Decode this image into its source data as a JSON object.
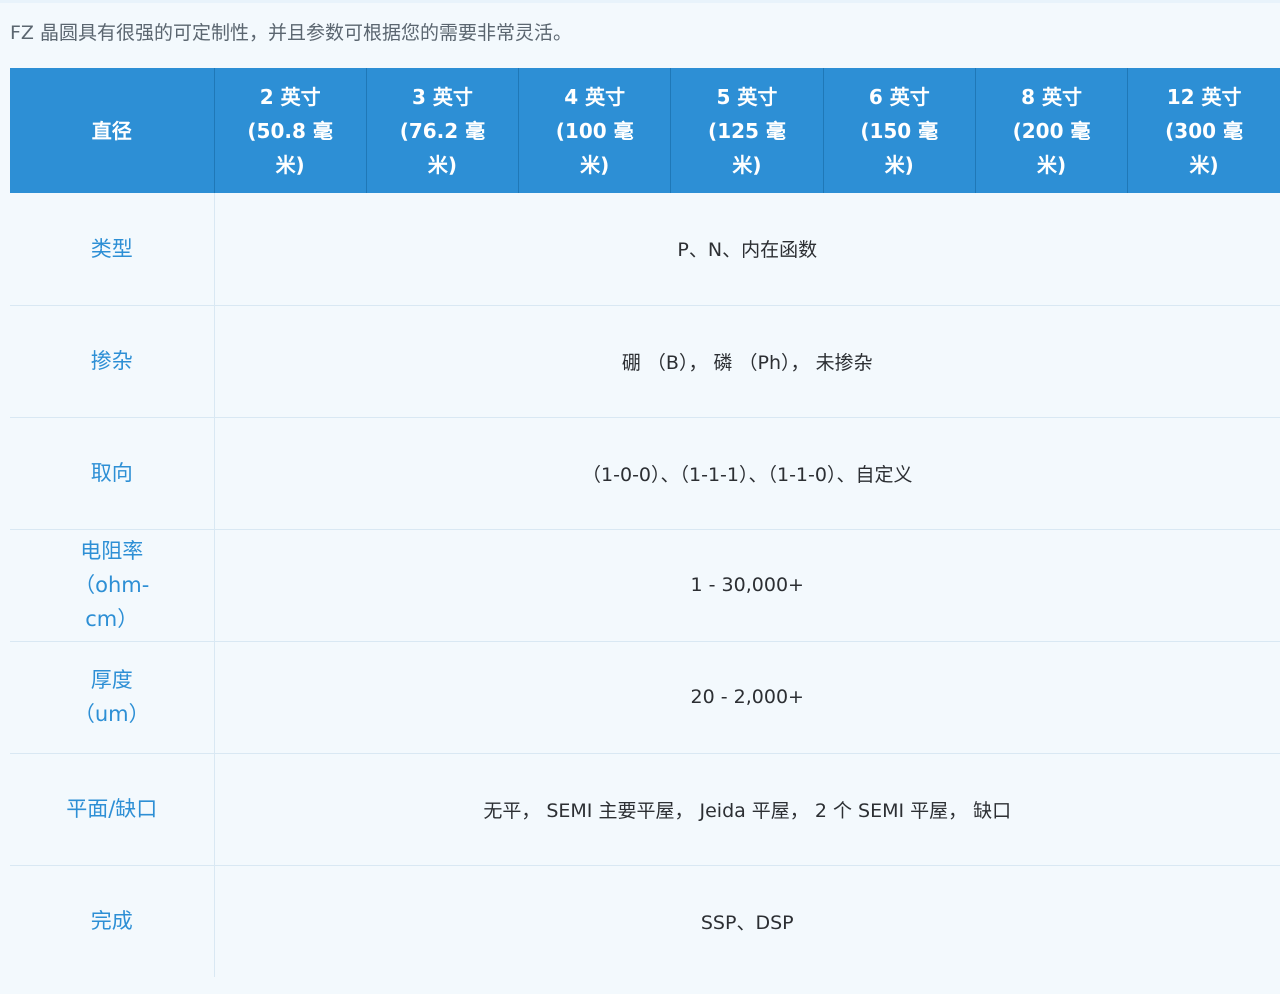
{
  "intro_text": "FZ 晶圆具有很强的可定制性，并且参数可根据您的需要非常灵活。",
  "table": {
    "header": {
      "label": "直径",
      "sizes": [
        {
          "lines": [
            "2 英寸",
            "(50.8 毫",
            "米)"
          ]
        },
        {
          "lines": [
            "3 英寸",
            "(76.2 毫",
            "米)"
          ]
        },
        {
          "lines": [
            "4 英寸",
            "(100 毫",
            "米)"
          ]
        },
        {
          "lines": [
            "5 英寸",
            "(125 毫",
            "米)"
          ]
        },
        {
          "lines": [
            "6 英寸",
            "(150 毫",
            "米)"
          ]
        },
        {
          "lines": [
            "8 英寸",
            "(200 毫",
            "米)"
          ]
        },
        {
          "lines": [
            "12 英寸",
            "(300 毫",
            "米)"
          ]
        }
      ]
    },
    "rows": [
      {
        "label_lines": [
          "类型"
        ],
        "value": "P、N、内在函数"
      },
      {
        "label_lines": [
          "掺杂"
        ],
        "value": "硼 （B）， 磷 （Ph）， 未掺杂"
      },
      {
        "label_lines": [
          "取向"
        ],
        "value": "（1-0-0）、（1-1-1）、（1-1-0）、自定义"
      },
      {
        "label_lines": [
          "电阻率",
          "（ohm-",
          "cm）"
        ],
        "value": "1 - 30,000+"
      },
      {
        "label_lines": [
          "厚度",
          "（um）"
        ],
        "value": "20 - 2,000+"
      },
      {
        "label_lines": [
          "平面/缺口"
        ],
        "value": "无平， SEMI 主要平屋， Jeida 平屋， 2 个 SEMI 平屋， 缺口"
      },
      {
        "label_lines": [
          "完成"
        ],
        "value": "SSP、DSP"
      }
    ]
  },
  "colors": {
    "header_bg": "#2d8fd5",
    "row_label": "#2d8fd5",
    "page_bg": "#f3f9fd"
  }
}
